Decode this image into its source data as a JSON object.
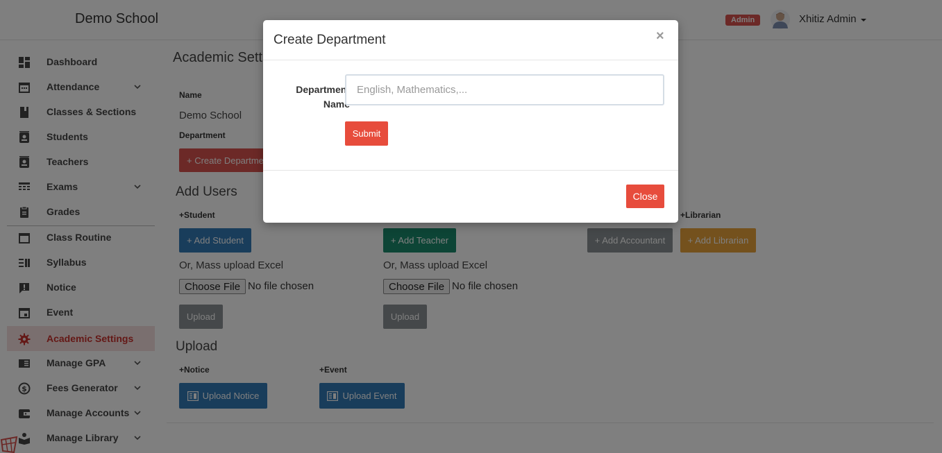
{
  "header": {
    "brand": "Demo School",
    "role_badge": "Admin",
    "user_name": "Xhitiz Admin",
    "avatar_icon": "user-avatar-icon"
  },
  "sidebar": {
    "items": [
      {
        "label": "Dashboard",
        "icon": "dashboard-icon",
        "expandable": false
      },
      {
        "label": "Attendance",
        "icon": "calendar-icon",
        "expandable": true
      },
      {
        "label": "Classes & Sections",
        "icon": "book-icon",
        "expandable": false
      },
      {
        "label": "Students",
        "icon": "contacts-icon",
        "expandable": false
      },
      {
        "label": "Teachers",
        "icon": "contacts-icon",
        "expandable": false
      },
      {
        "label": "Exams",
        "icon": "table-icon",
        "expandable": true
      },
      {
        "label": "Grades",
        "icon": "clipboard-icon",
        "expandable": false
      },
      {
        "label": "Class Routine",
        "icon": "calendar-blank-icon",
        "expandable": false
      },
      {
        "label": "Syllabus",
        "icon": "list-icon",
        "expandable": false
      },
      {
        "label": "Notice",
        "icon": "feedback-icon",
        "expandable": false
      },
      {
        "label": "Event",
        "icon": "event-icon",
        "expandable": false
      },
      {
        "label": "Academic Settings",
        "icon": "gear-icon",
        "expandable": false,
        "active": true
      },
      {
        "label": "Manage GPA",
        "icon": "chrome-reader-icon",
        "expandable": true
      },
      {
        "label": "Fees Generator",
        "icon": "dollar-icon",
        "expandable": true
      },
      {
        "label": "Manage Accounts",
        "icon": "wallet-icon",
        "expandable": true
      },
      {
        "label": "Manage Library",
        "icon": "library-icon",
        "expandable": true
      }
    ],
    "active_color": "#c9302c"
  },
  "main": {
    "title": "Academic Settings",
    "name_label": "Name",
    "school_name": "Demo School",
    "department_label": "Department",
    "create_department_button": "+ Create Department",
    "add_users_heading": "Add Users",
    "student_label": "+Student",
    "add_student_button": "+ Add Student",
    "mass_upload_student": "Or, Mass upload Excel",
    "choose_file_student": "Choose File",
    "no_file_student": "No file chosen",
    "upload_student_button": "Upload",
    "add_teacher_button": "+ Add Teacher",
    "mass_upload_teacher": "Or, Mass upload Excel",
    "choose_file_teacher": "Choose File",
    "no_file_teacher": "No file chosen",
    "upload_teacher_button": "Upload",
    "librarian_label": "+Librarian",
    "add_accountant_button": "+ Add Accountant",
    "add_librarian_button": "+ Add Librarian",
    "upload_heading": "Upload",
    "notice_label": "+Notice",
    "event_label": "+Event",
    "upload_notice_button": "Upload Notice",
    "upload_event_button": "Upload Event"
  },
  "modal": {
    "title": "Create Department",
    "close_symbol": "×",
    "field_label": "Department Name",
    "field_placeholder": "English, Mathematics,...",
    "submit_button": "Submit",
    "close_button": "Close"
  },
  "colors": {
    "primary": "#337ab7",
    "danger": "#d9534f",
    "success": "#1a8a6d",
    "secondary": "#8a9194",
    "warning": "#e8a33a"
  }
}
